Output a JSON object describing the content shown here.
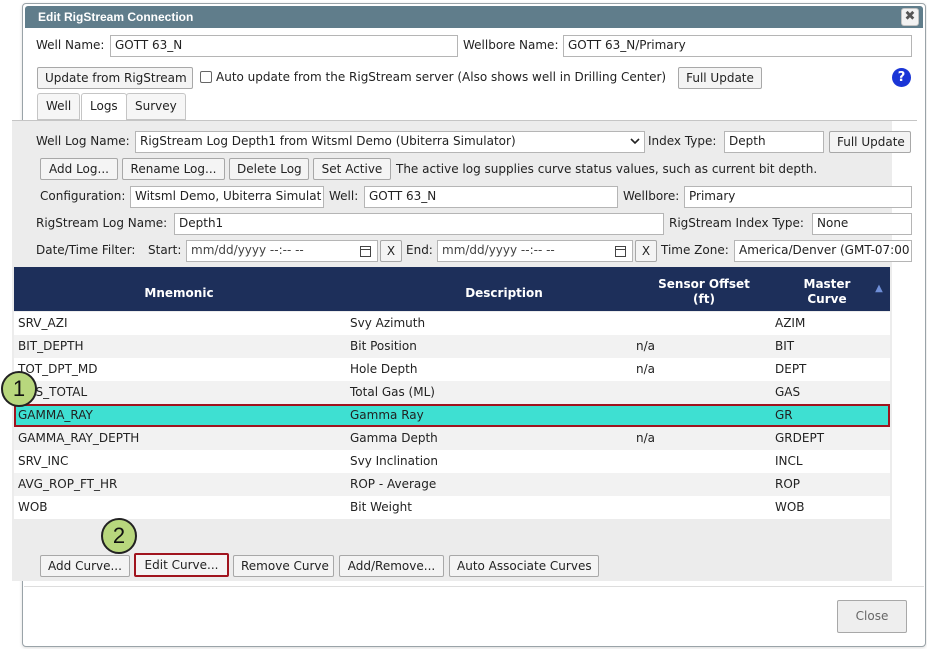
{
  "dialog": {
    "title": "Edit RigStream Connection",
    "close_glyph": "✖"
  },
  "well": {
    "well_name_label": "Well Name:",
    "well_name_value": "GOTT 63_N",
    "wellbore_name_label": "Wellbore Name:",
    "wellbore_name_value": "GOTT 63_N/Primary",
    "update_button": "Update from RigStream",
    "auto_update_label": "Auto update from the RigStream server (Also shows well in Drilling Center)",
    "full_update_button": "Full Update",
    "help_glyph": "?"
  },
  "tabs": [
    {
      "label": "Well",
      "active": false
    },
    {
      "label": "Logs",
      "active": true
    },
    {
      "label": "Survey",
      "active": false
    }
  ],
  "logs": {
    "well_log_name_label": "Well Log Name:",
    "well_log_name_value": "RigStream Log Depth1 from Witsml Demo (Ubiterra Simulator)",
    "index_type_label": "Index Type:",
    "index_type_value": "Depth",
    "full_update_button": "Full Update",
    "add_log_button": "Add Log...",
    "rename_log_button": "Rename Log...",
    "delete_log_button": "Delete Log",
    "set_active_button": "Set Active",
    "active_note": "The active log supplies curve status values, such as current bit depth.",
    "configuration_label": "Configuration:",
    "configuration_value": "Witsml Demo, Ubiterra Simulat",
    "well_label": "Well:",
    "well_value": "GOTT 63_N",
    "wellbore_label": "Wellbore:",
    "wellbore_value": "Primary",
    "rig_log_name_label": "RigStream Log Name:",
    "rig_log_name_value": "Depth1",
    "rig_index_type_label": "RigStream Index Type:",
    "rig_index_type_value": "None",
    "datetime_filter_label": "Date/Time Filter:",
    "start_label": "Start:",
    "start_placeholder": "mm/dd/yyyy --:-- --",
    "end_label": "End:",
    "end_placeholder": "mm/dd/yyyy --:-- --",
    "clear_glyph": "X",
    "time_zone_label": "Time Zone:",
    "time_zone_value": "America/Denver (GMT-07:00"
  },
  "grid": {
    "columns": [
      "Mnemonic",
      "Description",
      "Sensor Offset",
      "(ft)",
      "Master",
      "Curve"
    ],
    "sort_glyph": "▲",
    "rows": [
      {
        "mnemonic": "SRV_AZI",
        "description": "Svy Azimuth",
        "offset": "",
        "master": "AZIM"
      },
      {
        "mnemonic": "BIT_DEPTH",
        "description": "Bit Position",
        "offset": "n/a",
        "master": "BIT"
      },
      {
        "mnemonic": "TOT_DPT_MD",
        "description": "Hole Depth",
        "offset": "n/a",
        "master": "DEPT"
      },
      {
        "mnemonic": "GAS_TOTAL",
        "description": "Total Gas (ML)",
        "offset": "",
        "master": "GAS"
      },
      {
        "mnemonic": "GAMMA_RAY",
        "description": "Gamma Ray",
        "offset": "",
        "master": "GR"
      },
      {
        "mnemonic": "GAMMA_RAY_DEPTH",
        "description": "Gamma Depth",
        "offset": "n/a",
        "master": "GRDEPT"
      },
      {
        "mnemonic": "SRV_INC",
        "description": "Svy Inclination",
        "offset": "",
        "master": "INCL"
      },
      {
        "mnemonic": "AVG_ROP_FT_HR",
        "description": "ROP - Average",
        "offset": "",
        "master": "ROP"
      },
      {
        "mnemonic": "WOB",
        "description": "Bit Weight",
        "offset": "",
        "master": "WOB"
      }
    ]
  },
  "curve_buttons": {
    "add": "Add Curve...",
    "edit": "Edit Curve...",
    "remove": "Remove Curve",
    "add_remove": "Add/Remove...",
    "auto_associate": "Auto Associate Curves"
  },
  "footer": {
    "close_button": "Close"
  },
  "callouts": [
    "1",
    "2"
  ],
  "colors": {
    "titlebar": "#607d8b",
    "grid_header": "#1d2f5a",
    "selected_row": "#3ee0d2",
    "highlight_border": "#a0141e",
    "callout": "#b8d77d"
  }
}
